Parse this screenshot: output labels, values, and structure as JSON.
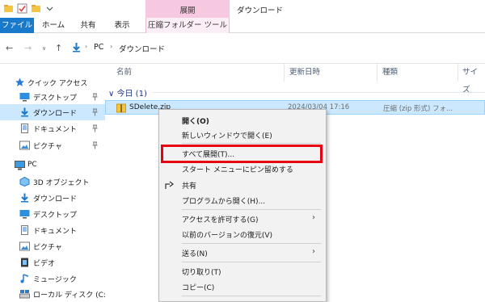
{
  "titlebar": {
    "context_label": "展開",
    "window_title": "ダウンロード"
  },
  "ribbon": {
    "tabs": [
      "ファイル",
      "ホーム",
      "共有",
      "表示",
      "圧縮フォルダー ツール"
    ]
  },
  "address": {
    "crumbs": [
      "PC",
      "ダウンロード"
    ]
  },
  "nav": {
    "quick_access": "クイック アクセス",
    "qa_items": [
      "デスクトップ",
      "ダウンロード",
      "ドキュメント",
      "ピクチャ"
    ],
    "pc": "PC",
    "pc_items": [
      "3D オブジェクト",
      "ダウンロード",
      "デスクトップ",
      "ドキュメント",
      "ピクチャ",
      "ビデオ",
      "ミュージック",
      "ローカル ディスク (C:)"
    ]
  },
  "columns": [
    "名前",
    "更新日時",
    "種類",
    "サイズ"
  ],
  "group": {
    "label": "今日 (1)"
  },
  "file": {
    "name": "SDelete.zip",
    "date": "2024/03/04 17:16",
    "type": "圧縮 (zip 形式) フォ..."
  },
  "menu": {
    "items": [
      "開く(O)",
      "新しいウィンドウで開く(E)",
      "すべて展開(T)...",
      "スタート メニューにピン留めする",
      "共有",
      "プログラムから開く(H)...",
      "アクセスを許可する(G)",
      "以前のバージョンの復元(V)",
      "送る(N)",
      "切り取り(T)",
      "コピー(C)"
    ]
  },
  "colors": {
    "accent": "#1979ca",
    "selection": "#cce8ff",
    "context_tab": "#f7c9e1",
    "highlight_box": "#e60012"
  }
}
